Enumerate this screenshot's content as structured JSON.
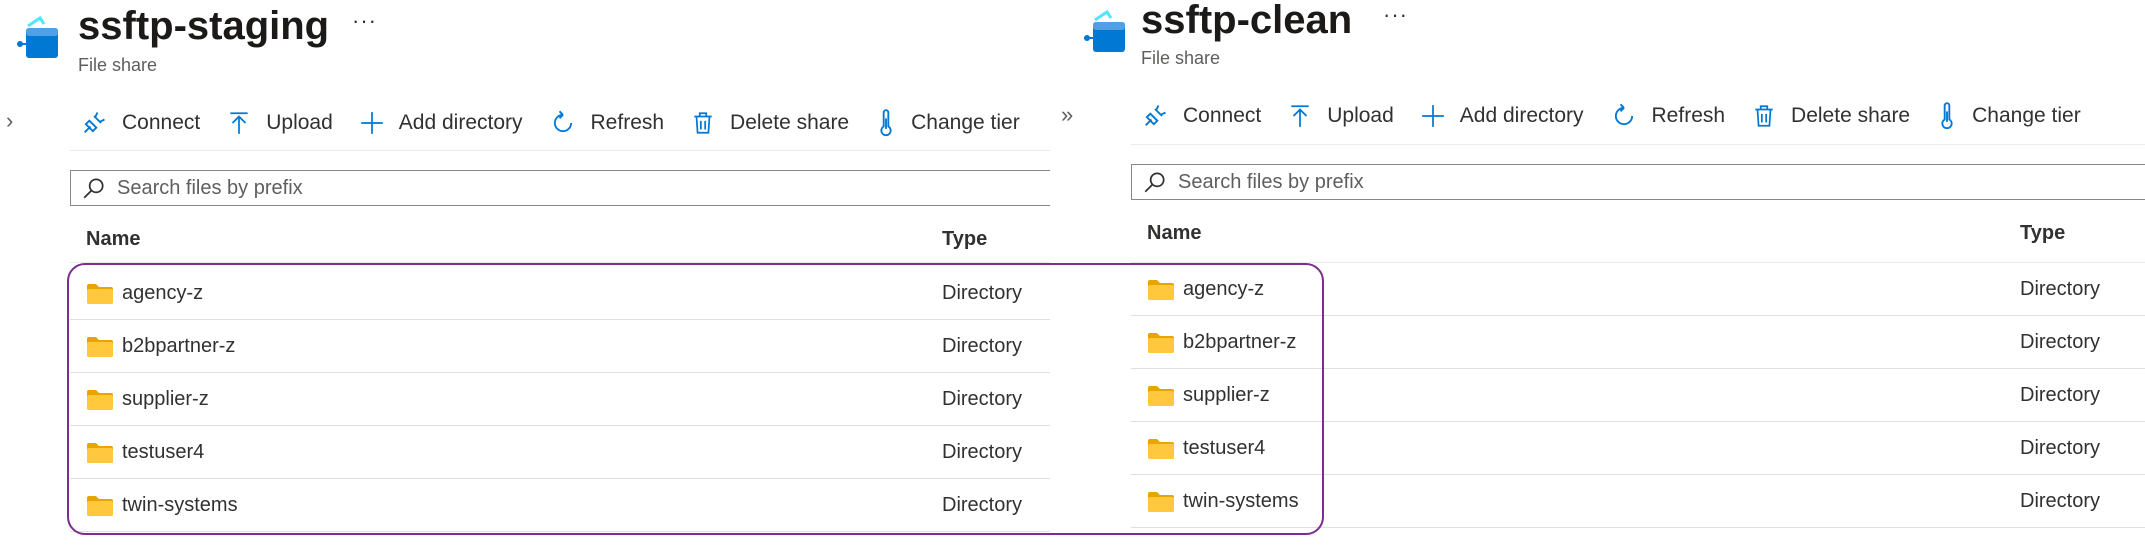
{
  "colors": {
    "accent": "#0078d4",
    "folder": "#ffc83d",
    "folder_dark": "#e8a500",
    "highlight": "#7b2e8d"
  },
  "columns": {
    "name": "Name",
    "type": "Type"
  },
  "toolbar": [
    {
      "label": "Connect",
      "icon": "plug-icon"
    },
    {
      "label": "Upload",
      "icon": "upload-icon"
    },
    {
      "label": "Add directory",
      "icon": "plus-icon"
    },
    {
      "label": "Refresh",
      "icon": "refresh-icon"
    },
    {
      "label": "Delete share",
      "icon": "trash-icon"
    },
    {
      "label": "Change tier",
      "icon": "thermometer-icon"
    }
  ],
  "search_placeholder": "Search files by prefix",
  "left": {
    "title": "ssftp-staging",
    "subtitle": "File share",
    "more": "···",
    "toggle": "›",
    "rows": [
      {
        "name": "agency-z",
        "type": "Directory"
      },
      {
        "name": "b2bpartner-z",
        "type": "Directory"
      },
      {
        "name": "supplier-z",
        "type": "Directory"
      },
      {
        "name": "testuser4",
        "type": "Directory"
      },
      {
        "name": "twin-systems",
        "type": "Directory"
      }
    ]
  },
  "right": {
    "title": "ssftp-clean",
    "subtitle": "File share",
    "more": "···",
    "toggle": "»",
    "rows": [
      {
        "name": "agency-z",
        "type": "Directory"
      },
      {
        "name": "b2bpartner-z",
        "type": "Directory"
      },
      {
        "name": "supplier-z",
        "type": "Directory"
      },
      {
        "name": "testuser4",
        "type": "Directory"
      },
      {
        "name": "twin-systems",
        "type": "Directory"
      }
    ]
  }
}
